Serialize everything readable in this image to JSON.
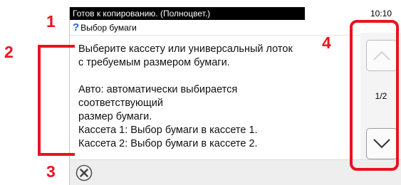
{
  "status": {
    "text": "Готов к копированию. (Полноцвет.)",
    "time": "10:10"
  },
  "title": {
    "icon": "help-icon",
    "icon_glyph": "?",
    "label": "Выбор бумаги"
  },
  "content": {
    "line1": "Выберите кассету или универсальный лоток",
    "line2": "с требуемым размером бумаги.",
    "line3": "Авто: автоматически выбирается",
    "line4": "соответствующий",
    "line5": "размер бумаги.",
    "line6": "Кассета 1: Выбор бумаги в кассете 1.",
    "line7": "Кассета 2: Выбор бумаги в кассете 2."
  },
  "scroll": {
    "page_indicator": "1/2",
    "up_icon": "chevron-up-icon",
    "down_icon": "chevron-down-icon",
    "up_enabled": false,
    "down_enabled": true
  },
  "close": {
    "icon": "close-icon"
  },
  "callouts": {
    "one": "1",
    "two": "2",
    "three": "3",
    "four": "4"
  },
  "colors": {
    "callout_red": "#e8141e",
    "help_blue": "#1f63c7",
    "status_bg": "#000000"
  }
}
